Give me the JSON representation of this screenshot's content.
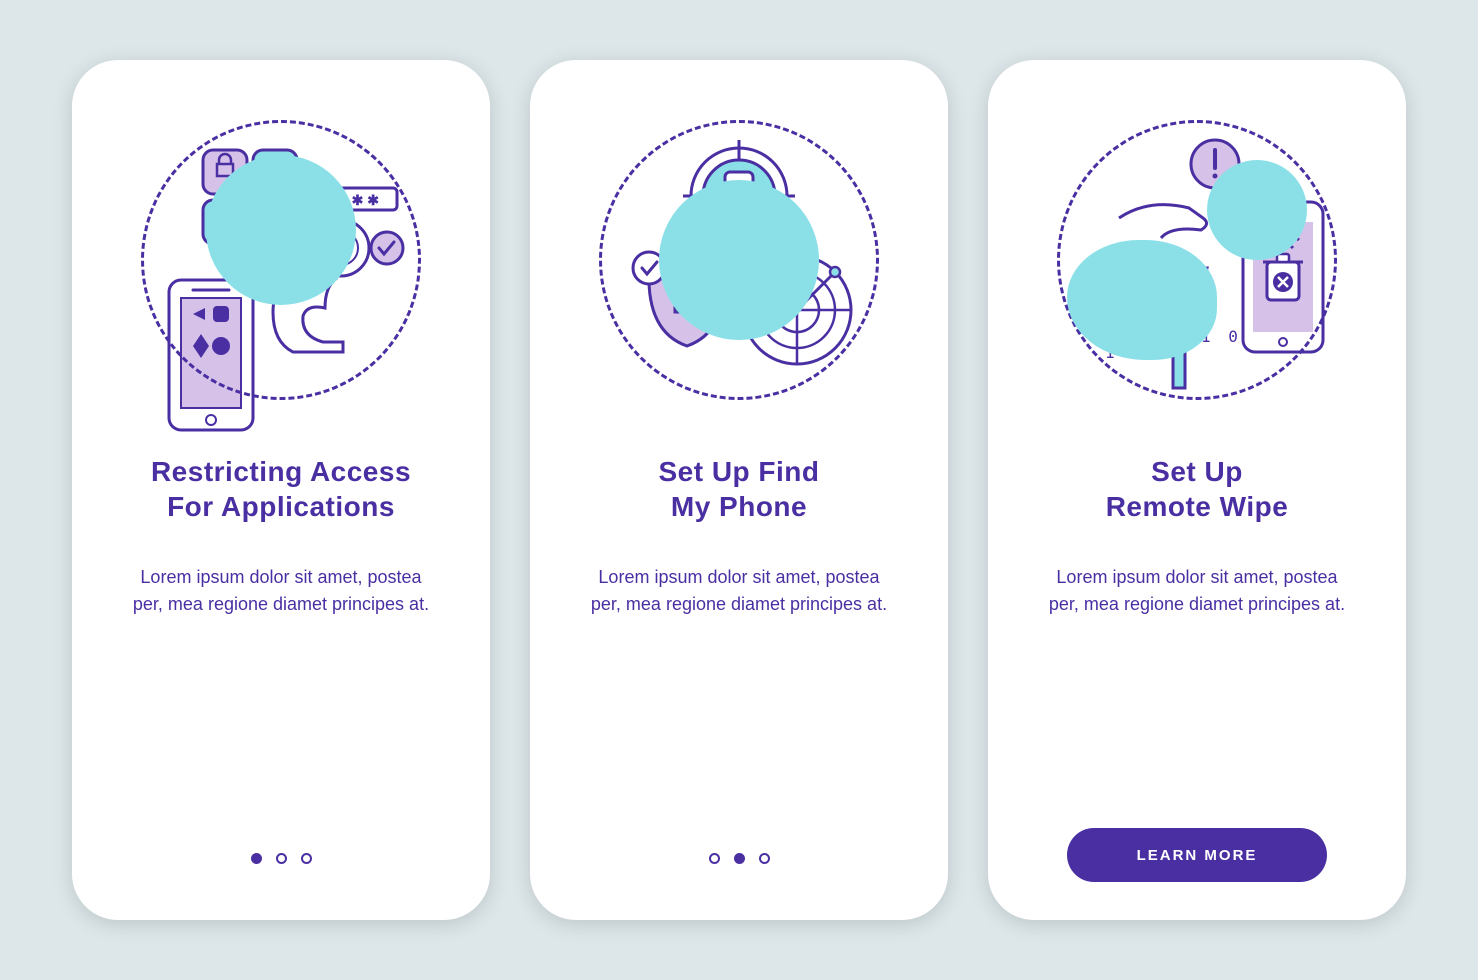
{
  "colors": {
    "primary": "#4a2fa3",
    "accent_cyan": "#8be0e8",
    "accent_lilac": "#d6c2e8",
    "background": "#dde7ea",
    "card": "#ffffff"
  },
  "screens": [
    {
      "title": "Restricting Access\nFor Applications",
      "description": "Lorem ipsum dolor sit amet, postea per, mea regione diamet principes at.",
      "button": null,
      "pager_index": 0,
      "illustration": "app-lock-icon"
    },
    {
      "title": "Set Up Find\nMy Phone",
      "description": "Lorem ipsum dolor sit amet, postea per, mea regione diamet principes at.",
      "button": null,
      "pager_index": 1,
      "illustration": "find-phone-icon"
    },
    {
      "title": "Set Up\nRemote Wipe",
      "description": "Lorem ipsum dolor sit amet, postea per, mea regione diamet principes at.",
      "button": "LEARN MORE",
      "pager_index": null,
      "illustration": "remote-wipe-icon"
    }
  ]
}
